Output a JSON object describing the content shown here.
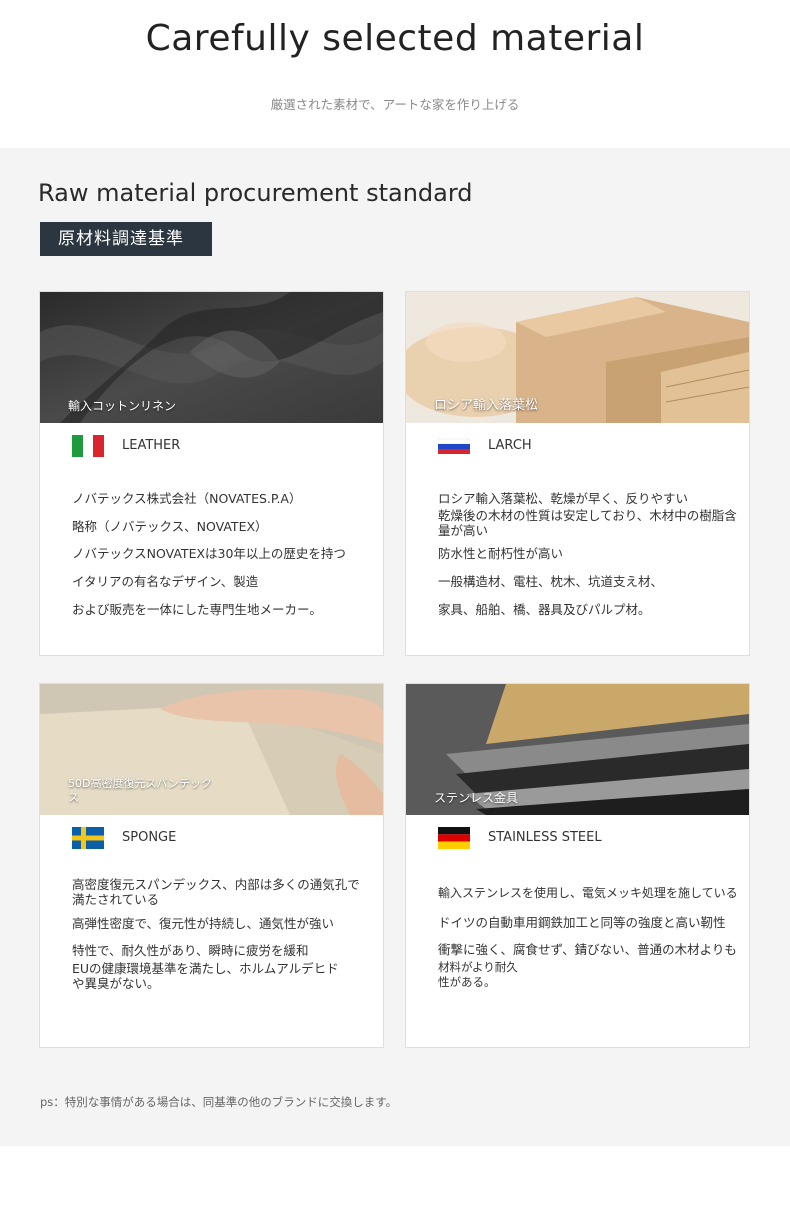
{
  "header": {
    "title": "Carefully selected material",
    "subtitle": "厳選された素材で、アートな家を作り上げる"
  },
  "section": {
    "title": "Raw material procurement standard",
    "badge": "原材料調達基準",
    "note": "ps：特別な事情がある場合は、同基準の他のブランドに交換します。"
  },
  "cards": [
    {
      "caption": "輸入コットンリネン",
      "flag": "italy-flag-icon",
      "name": "LEATHER",
      "lines": [
        "ノバテックス株式会社（NOVATES.P.A）",
        "略称（ノバテックス、NOVATEX）",
        "ノバテックスNOVATEXは30年以上の歴史を持つ",
        "イタリアの有名なデザイン、製造",
        "および販売を一体にした専門生地メーカー。"
      ]
    },
    {
      "caption": "ロシア輸入落葉松",
      "flag": "russia-flag-icon",
      "name": "LARCH",
      "lines": [
        "ロシア輸入落葉松、乾燥が早く、反りやすい",
        "乾燥後の木材の性質は安定しており、木材中の樹脂含量が高い",
        "防水性と耐朽性が高い",
        "一般構造材、電柱、枕木、坑道支え材、",
        "家具、船舶、橋、器具及びパルプ材。"
      ]
    },
    {
      "caption": "50D高密度復元スパンデックス",
      "flag": "sweden-flag-icon",
      "name": "SPONGE",
      "lines": [
        "高密度復元スパンデックス、内部は多くの通気孔で満たされている",
        "高弾性密度で、復元性が持続し、通気性が強い",
        "特性で、耐久性があり、瞬時に疲労を緩和",
        "EUの健康環境基準を満たし、ホルムアルデヒドや異臭がない。"
      ]
    },
    {
      "caption": "ステンレス金具",
      "flag": "germany-flag-icon",
      "name": "STAINLESS STEEL",
      "lines": [
        "輸入ステンレスを使用し、電気メッキ処理を施している",
        "ドイツの自動車用鋼鉄加工と同等の強度と高い靭性",
        "衝撃に強く、腐食せず、錆びない、普通の木材よりも",
        "材料がより耐久性がある。"
      ]
    }
  ]
}
